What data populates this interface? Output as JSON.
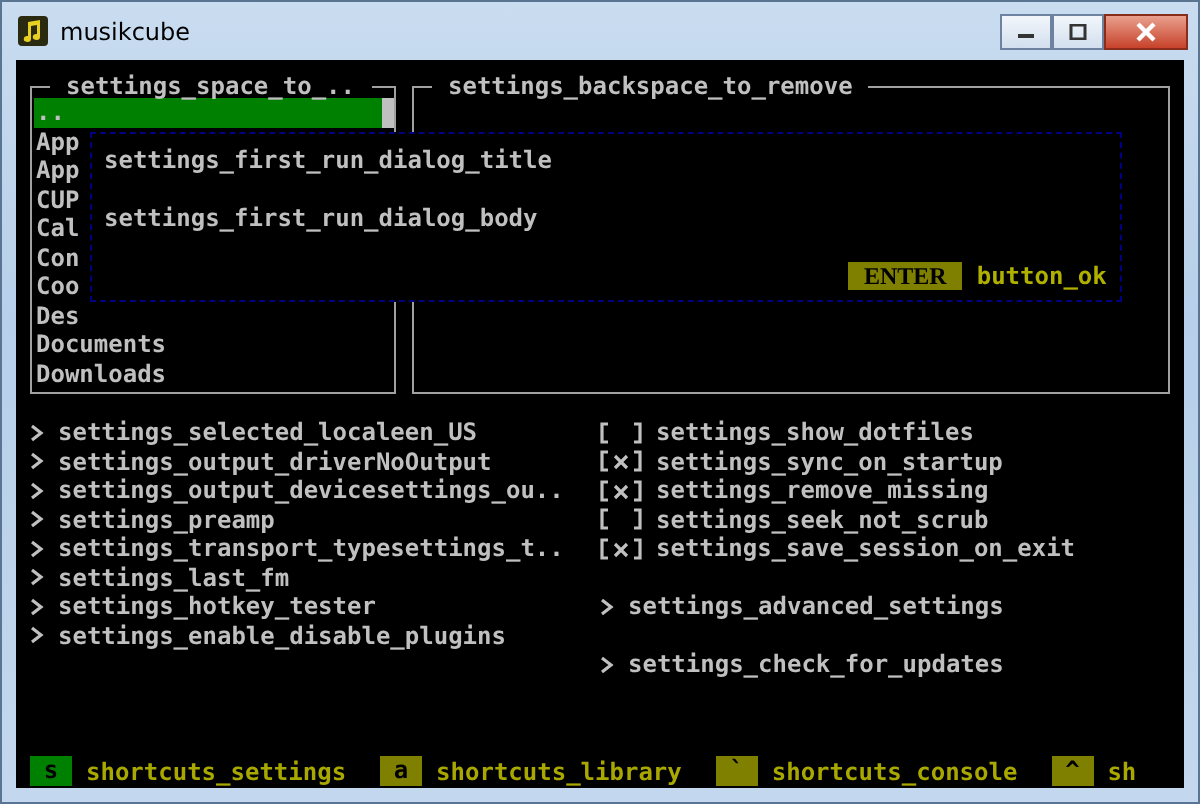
{
  "window": {
    "title": "musikcube"
  },
  "browser": {
    "title": "settings_space_to_..",
    "items": [
      {
        "label": "..",
        "selected": true
      },
      {
        "label": "App",
        "selected": false
      },
      {
        "label": "App",
        "selected": false
      },
      {
        "label": "CUP",
        "selected": false
      },
      {
        "label": "Cal",
        "selected": false
      },
      {
        "label": "Con",
        "selected": false
      },
      {
        "label": "Coo",
        "selected": false
      },
      {
        "label": "Des",
        "selected": false
      },
      {
        "label": "Documents",
        "selected": false
      },
      {
        "label": "Downloads",
        "selected": false
      }
    ]
  },
  "paths": {
    "title": "settings_backspace_to_remove"
  },
  "dialog": {
    "title": "settings_first_run_dialog_title",
    "body": "settings_first_run_dialog_body",
    "button": {
      "key": "ENTER",
      "label": "button_ok"
    }
  },
  "settings_left": [
    {
      "kind": "link",
      "label": "settings_selected_localeen_US"
    },
    {
      "kind": "link",
      "label": "settings_output_driverNoOutput"
    },
    {
      "kind": "link",
      "label": "settings_output_devicesettings_ou.."
    },
    {
      "kind": "link",
      "label": "settings_preamp"
    },
    {
      "kind": "link",
      "label": "settings_transport_typesettings_t.."
    },
    {
      "kind": "link",
      "label": "settings_last_fm"
    },
    {
      "kind": "link",
      "label": "settings_hotkey_tester"
    },
    {
      "kind": "link",
      "label": "settings_enable_disable_plugins"
    }
  ],
  "settings_right": [
    {
      "kind": "checkbox",
      "label": "settings_show_dotfiles",
      "checked": false
    },
    {
      "kind": "checkbox",
      "label": "settings_sync_on_startup",
      "checked": true
    },
    {
      "kind": "checkbox",
      "label": "settings_remove_missing",
      "checked": true
    },
    {
      "kind": "checkbox",
      "label": "settings_seek_not_scrub",
      "checked": false
    },
    {
      "kind": "checkbox",
      "label": "settings_save_session_on_exit",
      "checked": true
    },
    {
      "kind": "gap"
    },
    {
      "kind": "link",
      "label": "settings_advanced_settings"
    },
    {
      "kind": "gap"
    },
    {
      "kind": "link",
      "label": "settings_check_for_updates"
    }
  ],
  "shortcuts": [
    {
      "key": "s",
      "label": "shortcuts_settings",
      "selected": true
    },
    {
      "key": "a",
      "label": "shortcuts_library",
      "selected": false
    },
    {
      "key": "`",
      "label": "shortcuts_console",
      "selected": false
    },
    {
      "key": "^",
      "label": "sh",
      "selected": false
    }
  ]
}
